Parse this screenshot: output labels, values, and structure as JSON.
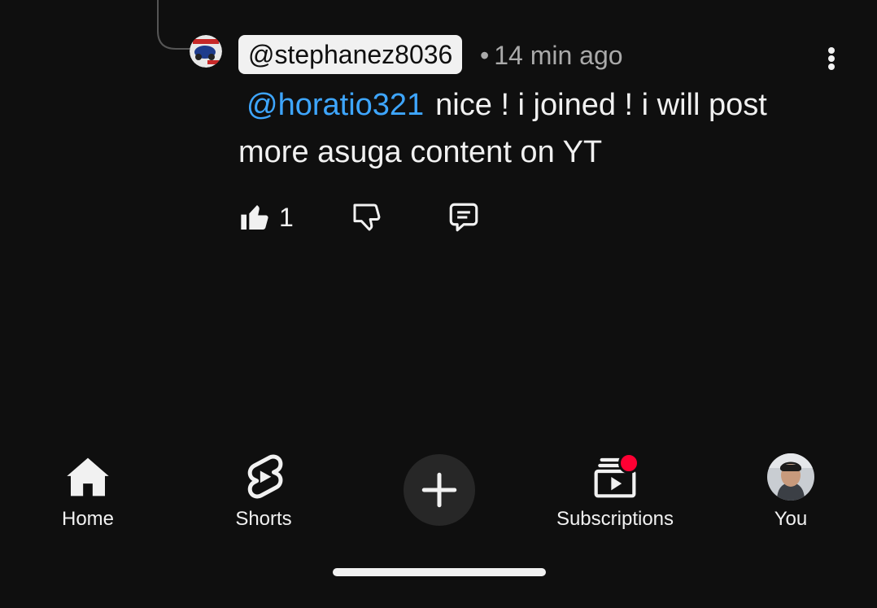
{
  "comment": {
    "author": "@stephanez8036",
    "dot": "•",
    "time": "14 min ago",
    "mention": "@horatio321",
    "text": "nice ! i joined ! i will post more asuga content on YT",
    "likes": "1"
  },
  "icons": {
    "avatar": "user-avatar-icon",
    "more": "more-vert-icon",
    "like": "thumbs-up-icon",
    "dislike": "thumbs-down-icon",
    "reply": "reply-comment-icon"
  },
  "nav": {
    "home": "Home",
    "shorts": "Shorts",
    "subscriptions": "Subscriptions",
    "you": "You"
  },
  "colors": {
    "background": "#0f0f0f",
    "mention": "#3ea6ff",
    "notification": "#ff0033"
  }
}
